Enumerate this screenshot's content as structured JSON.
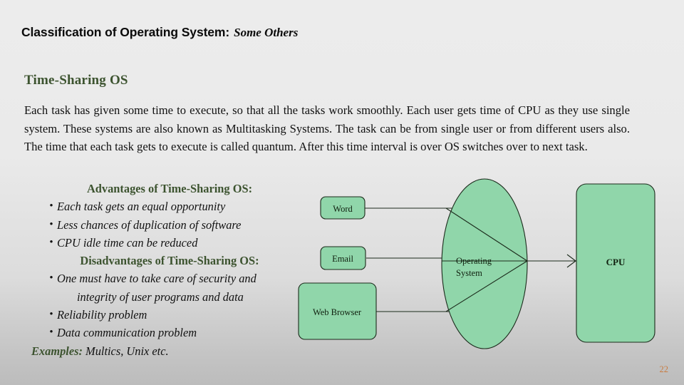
{
  "slide": {
    "background_color": "#e8e8e8",
    "accent_green": "#3c532f",
    "shape_fill": "#90d6aa",
    "page_number_color": "#c97b40",
    "page_number": "22"
  },
  "title": {
    "main": "Classification of Operating System:",
    "subtitle": "Some Others"
  },
  "section": {
    "heading": "Time-Sharing OS",
    "paragraph": "Each task has given some time to execute, so that all the tasks work smoothly. Each user gets time of CPU as they use single system. These systems are also known as Multitasking Systems. The task can be from single user or from different users also. The time that each task gets to execute is called quantum. After this time interval is over OS switches over to next task."
  },
  "advantages": {
    "heading": "Advantages of Time-Sharing OS:",
    "items": [
      "Each task gets an equal opportunity",
      "Less chances of duplication of software",
      "CPU idle time can be reduced"
    ]
  },
  "disadvantages": {
    "heading": "Disadvantages of Time-Sharing OS:",
    "items": [
      "One must have to take care of security and",
      "Reliability problem",
      "Data communication problem"
    ],
    "continuation": "integrity of user programs and data"
  },
  "examples": {
    "label": "Examples:",
    "value": "Multics, Unix etc."
  },
  "diagram": {
    "bullet_glyph": "•",
    "nodes": {
      "word": "Word",
      "email": "Email",
      "web_browser": "Web Browser",
      "operating_system_line1": "Operating",
      "operating_system_line2": "System",
      "cpu": "CPU"
    }
  }
}
